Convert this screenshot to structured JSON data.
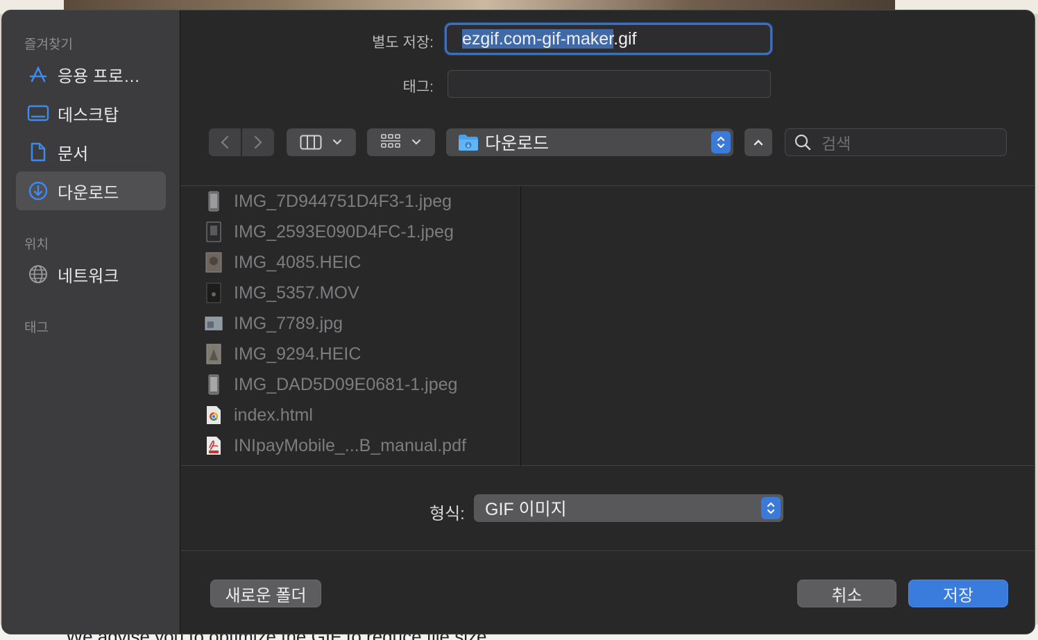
{
  "backdrop": {
    "bottom_text": "We advise you to optimize the GIF to reduce file size."
  },
  "sidebar": {
    "favorites_title": "즐겨찾기",
    "favorites": [
      {
        "label": "응용 프로…",
        "icon": "applications-icon"
      },
      {
        "label": "데스크탑",
        "icon": "desktop-icon"
      },
      {
        "label": "문서",
        "icon": "document-icon"
      },
      {
        "label": "다운로드",
        "icon": "download-icon",
        "active": true
      }
    ],
    "locations_title": "위치",
    "locations": [
      {
        "label": "네트워크",
        "icon": "globe-icon"
      }
    ],
    "tags_title": "태그"
  },
  "save_as": {
    "label": "별도 저장:",
    "value_selected": "ezgif.com-gif-maker",
    "value_ext": ".gif"
  },
  "tags": {
    "label": "태그:",
    "value": ""
  },
  "toolbar": {
    "current_folder": "다운로드",
    "search_placeholder": "검색"
  },
  "files": [
    {
      "name": "IMG_7D944751D4F3-1.jpeg",
      "icon": "phone-image-icon"
    },
    {
      "name": "IMG_2593E090D4FC-1.jpeg",
      "icon": "phone-image-icon"
    },
    {
      "name": "IMG_4085.HEIC",
      "icon": "photo-thumbnail-icon"
    },
    {
      "name": "IMG_5357.MOV",
      "icon": "video-thumbnail-icon"
    },
    {
      "name": "IMG_7789.jpg",
      "icon": "photo-thumbnail-icon"
    },
    {
      "name": "IMG_9294.HEIC",
      "icon": "photo-thumbnail-icon"
    },
    {
      "name": "IMG_DAD5D09E0681-1.jpeg",
      "icon": "phone-image-icon"
    },
    {
      "name": "index.html",
      "icon": "chrome-html-icon"
    },
    {
      "name": "INIpayMobile_...B_manual.pdf",
      "icon": "pdf-icon"
    }
  ],
  "format": {
    "label": "형식:",
    "value": "GIF 이미지"
  },
  "buttons": {
    "new_folder": "새로운 폴더",
    "cancel": "취소",
    "save": "저장"
  },
  "colors": {
    "accent": "#3a7cdd",
    "sidebar": "#3c3c3e",
    "panel": "#282829"
  }
}
